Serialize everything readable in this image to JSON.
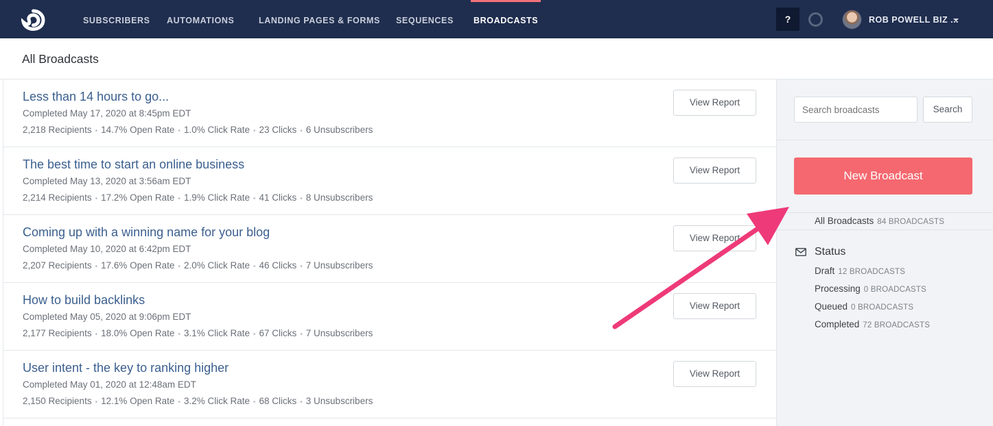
{
  "nav": {
    "items": [
      {
        "label": "SUBSCRIBERS"
      },
      {
        "label": "AUTOMATIONS"
      },
      {
        "label": "LANDING PAGES & FORMS"
      },
      {
        "label": "SEQUENCES"
      },
      {
        "label": "BROADCASTS",
        "active": true
      }
    ],
    "help_label": "?",
    "user_name": "ROB POWELL BIZ ...",
    "logo_icon": "convertkit-logo-icon",
    "accent_color": "#f2717a",
    "background_color": "#1f2d4e"
  },
  "page": {
    "title": "All Broadcasts"
  },
  "broadcasts": [
    {
      "title": "Less than 14 hours to go...",
      "completed": "Completed May 17, 2020 at 8:45pm EDT",
      "recipients": "2,218 Recipients",
      "open_rate": "14.7% Open Rate",
      "click_rate": "1.0% Click Rate",
      "clicks": "23 Clicks",
      "unsubscribers": "6 Unsubscribers",
      "button_label": "View Report"
    },
    {
      "title": "The best time to start an online business",
      "completed": "Completed May 13, 2020 at 3:56am EDT",
      "recipients": "2,214 Recipients",
      "open_rate": "17.2% Open Rate",
      "click_rate": "1.9% Click Rate",
      "clicks": "41 Clicks",
      "unsubscribers": "8 Unsubscribers",
      "button_label": "View Report"
    },
    {
      "title": "Coming up with a winning name for your blog",
      "completed": "Completed May 10, 2020 at 6:42pm EDT",
      "recipients": "2,207 Recipients",
      "open_rate": "17.6% Open Rate",
      "click_rate": "2.0% Click Rate",
      "clicks": "46 Clicks",
      "unsubscribers": "7 Unsubscribers",
      "button_label": "View Report"
    },
    {
      "title": "How to build backlinks",
      "completed": "Completed May 05, 2020 at 9:06pm EDT",
      "recipients": "2,177 Recipients",
      "open_rate": "18.0% Open Rate",
      "click_rate": "3.1% Click Rate",
      "clicks": "67 Clicks",
      "unsubscribers": "7 Unsubscribers",
      "button_label": "View Report"
    },
    {
      "title": "User intent - the key to ranking higher",
      "completed": "Completed May 01, 2020 at 12:48am EDT",
      "recipients": "2,150 Recipients",
      "open_rate": "12.1% Open Rate",
      "click_rate": "3.2% Click Rate",
      "clicks": "68 Clicks",
      "unsubscribers": "3 Unsubscribers",
      "button_label": "View Report"
    }
  ],
  "sidebar": {
    "search_placeholder": "Search broadcasts",
    "search_button": "Search",
    "new_button": "New Broadcast",
    "new_button_color": "#f5686f",
    "all_label": "All Broadcasts",
    "all_count": "84 BROADCASTS",
    "status_title": "Status",
    "status_icon": "envelope-icon",
    "statuses": [
      {
        "label": "Draft",
        "count": "12 BROADCASTS"
      },
      {
        "label": "Processing",
        "count": "0 BROADCASTS"
      },
      {
        "label": "Queued",
        "count": "0 BROADCASTS"
      },
      {
        "label": "Completed",
        "count": "72 BROADCASTS"
      }
    ]
  },
  "annotation": {
    "arrow_color": "#ee3a78",
    "arrow_icon": "pointer-arrow-annotation"
  }
}
